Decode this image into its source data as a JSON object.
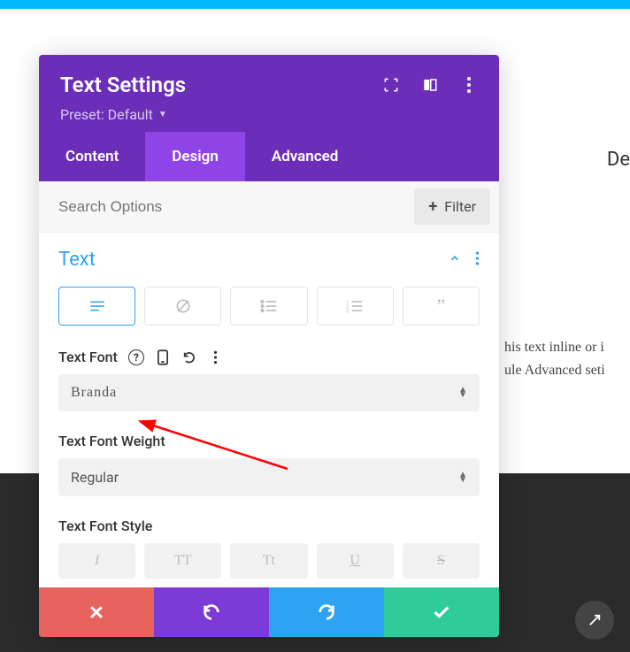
{
  "header": {
    "title": "Text Settings",
    "preset_label": "Preset: Default"
  },
  "tabs": {
    "content": "Content",
    "design": "Design",
    "advanced": "Advanced",
    "active": "design"
  },
  "search": {
    "placeholder": "Search Options"
  },
  "filter": {
    "label": "Filter"
  },
  "section": {
    "title": "Text"
  },
  "font": {
    "label": "Text Font",
    "value": "Branda"
  },
  "weight": {
    "label": "Text Font Weight",
    "value": "Regular"
  },
  "style": {
    "label": "Text Font Style",
    "italic": "I",
    "uppercase": "TT",
    "capitalize": "Tt",
    "underline": "U",
    "strike": "S"
  },
  "bg": {
    "right_text": "De",
    "hand1": "his text inline or i",
    "hand2": "ule Advanced seti"
  },
  "help_glyph": "?"
}
